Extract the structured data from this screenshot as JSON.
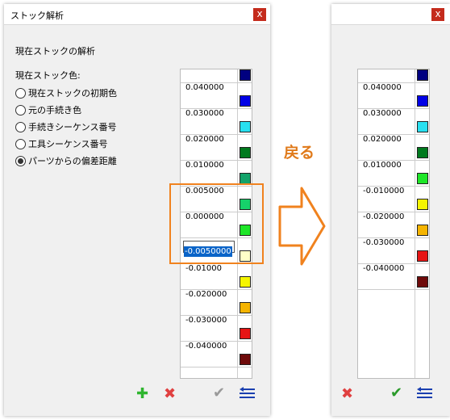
{
  "left_window": {
    "title": "ストック解析",
    "close_label": "x",
    "section_title": "現在ストックの解析",
    "stock_color_label": "現在ストック色:",
    "options": [
      {
        "label": "現在ストックの初期色",
        "checked": false
      },
      {
        "label": "元の手続き色",
        "checked": false
      },
      {
        "label": "手続きシーケンス番号",
        "checked": false
      },
      {
        "label": "工具シーケンス番号",
        "checked": false
      },
      {
        "label": "パーツからの偏差距離",
        "checked": true
      }
    ],
    "rows": [
      {
        "value": "0.040000",
        "color": "#000080"
      },
      {
        "value": "0.030000",
        "color": "#0000e6"
      },
      {
        "value": "0.020000",
        "color": "#28e0f0"
      },
      {
        "value": "0.010000",
        "color": "#007a1e"
      },
      {
        "value": "0.005000",
        "color": "#13a36a"
      },
      {
        "value": "0.000000",
        "color": "#16d26a"
      },
      {
        "value": "-0.0050000",
        "color": "#1ee628"
      },
      {
        "value": "-0.01000",
        "color": "#ffffc8"
      },
      {
        "value": "-0.020000",
        "color": "#f5f500"
      },
      {
        "value": "-0.030000",
        "color": "#f5b400"
      },
      {
        "value": "-0.040000",
        "color": "#e61414"
      },
      {
        "value": "",
        "color": "#6e0a0a"
      }
    ],
    "editing_value": "-0.0050000"
  },
  "arrow_label": "戻る",
  "right_window": {
    "close_label": "x",
    "rows": [
      {
        "value": "0.040000",
        "color": "#000080"
      },
      {
        "value": "0.030000",
        "color": "#0000e6"
      },
      {
        "value": "0.020000",
        "color": "#28e0f0"
      },
      {
        "value": "0.010000",
        "color": "#007a1e"
      },
      {
        "value": "-0.010000",
        "color": "#1ee628"
      },
      {
        "value": "-0.020000",
        "color": "#f5f500"
      },
      {
        "value": "-0.030000",
        "color": "#f5b400"
      },
      {
        "value": "-0.040000",
        "color": "#e61414"
      },
      {
        "value": "",
        "color": "#6e0a0a"
      }
    ]
  },
  "toolbar_icons": {
    "add": "plus-icon",
    "delete": "cross-icon",
    "apply": "check-icon",
    "restore": "restore-list-icon"
  },
  "colors": {
    "accent_orange": "#f0821e",
    "close_red": "#c42b1c"
  }
}
